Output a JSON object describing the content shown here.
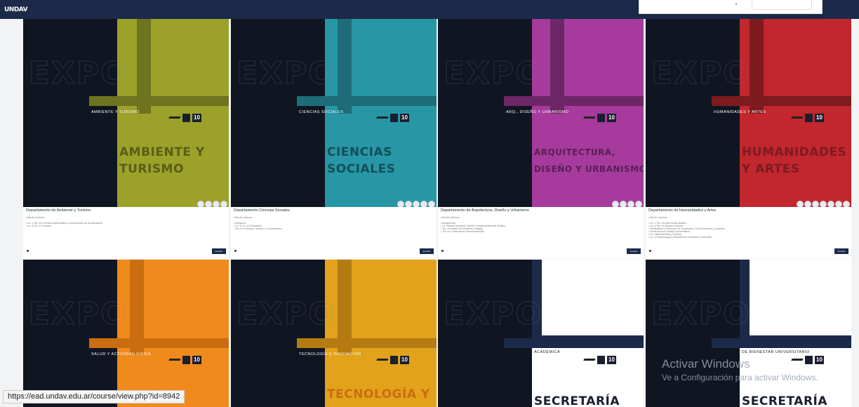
{
  "header": {
    "logo_text": "UNDAV"
  },
  "cards": [
    {
      "small_label": "AMBIENTE Y TURISMO",
      "big_title": "AMBIENTE Y\nTURISMO",
      "color": "#9ca12a",
      "stripe_color": "#6e7320",
      "title": "Departamento de Ambiente y Turismo",
      "lines": [
        "• Lic. y Tec. en Ciencias Ambientales y Conservación de la Naturaleza",
        "• Lic. y Tec. en Turismo"
      ],
      "dots": 4
    },
    {
      "small_label": "CIENCIAS SOCIALES",
      "big_title": "CIENCIAS\nSOCIALES",
      "color": "#2797a6",
      "stripe_color": "#1d6c78",
      "title": "Departamento Ciencias Sociales",
      "lines": [
        "• Abogacía",
        "• Lic. y Lic. en Periodismo",
        "• Tec. en Gobierno, Gestión y Comunicación"
      ],
      "dots": 5
    },
    {
      "small_label": "ARQ., DISEÑO Y URBANISMO",
      "big_title": "ARQUITECTURA,\nDISEÑO Y URBANISMO",
      "color": "#a63a9d",
      "stripe_color": "#6e2766",
      "title": "Departamento de Arquitectura, Diseño y Urbanismo",
      "lines": [
        "• Arquitectura",
        "• Lic. Diseño Industrial / Diseño Fundamentalmente Gráfico",
        "• Tec. en Diseño de Muebles y Objetos",
        "• Tec. en Construcción Semiconstruidas"
      ],
      "dots": 4
    },
    {
      "small_label": "HUMANIDADES Y ARTES",
      "big_title": "HUMANIDADES\nY ARTES",
      "color": "#c1272d",
      "stripe_color": "#7d1b1f",
      "title": "Departamento de Humanidades y Artes",
      "lines": [
        "• Lic. y Tec. en Artes Audiovisuales",
        "• Lic. y Tec. en Gestión Cultural",
        "• Tecnicatura en Dirección de Orquestas y Coros Infantiles y Juveniles",
        "• Tecnicatura en Gestión Universitaria",
        "• Lic. Instrumentista y Docente",
        "• Lic. en Museología y Repositorios Culturales y Naturales"
      ],
      "dots": 7
    },
    {
      "small_label": "SALUD Y ACTIVIDAD FÍSICA",
      "color": "#f08a1c",
      "stripe_color": "#c96d10"
    },
    {
      "small_label": "TECNOLOGÍA E INNOVACIÓN",
      "big_title": "TECNOLOGÍA Y",
      "color": "#e2a21b",
      "stripe_color": "#b47b12"
    },
    {
      "small_label": "ACADÉMICA",
      "big_title": "SECRETARÍA"
    },
    {
      "small_label": "DE BIENESTAR UNIVERSITARIO",
      "big_title": "SECRETARÍA"
    }
  ],
  "card_meta": "Lista de carreras:",
  "acceder_label": "Acceder",
  "windows_watermark": {
    "line1": "Activar Windows",
    "line2": "Ve a Configuración para activar Windows."
  },
  "status_url": "https://ead.undav.edu.ar/course/view.php?id=8942"
}
